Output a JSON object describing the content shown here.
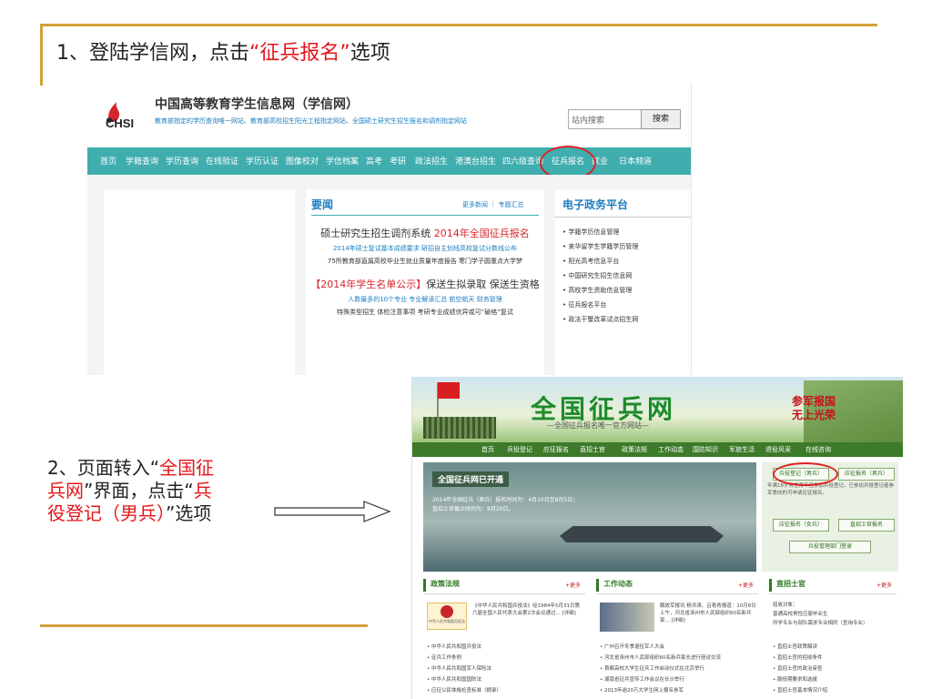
{
  "slide": {
    "step1_prefix": "1、登陆学信网，点击",
    "step1_highlight": "“征兵报名”",
    "step1_suffix": "选项",
    "step2_a": "2、页面转入“",
    "step2_b": "全国征兵网",
    "step2_c": "”界面，点击“",
    "step2_d": "兵役登记（男兵）",
    "step2_e": "”选项",
    "accent_color": "#d4a13a",
    "highlight_color": "#e3161a"
  },
  "chsi": {
    "logo_text": "CHSI",
    "site_title": "中国高等教育学生信息网（学信网）",
    "site_subtitle": "教育部指定的学历查询唯一网站、教育部高校招生阳光工程指定网站、全国硕士研究生招生报名和调剂指定网站",
    "search_placeholder": "站内搜索",
    "search_button": "搜索",
    "nav": [
      "首页",
      "学籍查询",
      "学历查询",
      "在线验证",
      "学历认证",
      "图像校对",
      "学信档案",
      "高考",
      "考研",
      "政法招生",
      "港澳台招生",
      "四六级查询",
      "征兵报名",
      "就业",
      "日本频道"
    ],
    "news": {
      "title": "要闻",
      "more": "更多新闻 ｜ 专题汇总",
      "headline1_a": "硕士研究生招生调剂系统",
      "headline1_b": "2014年全国征兵报名",
      "line1": "2014年硕士复试基本成绩要求 研招自主划线高校复试分数线公布",
      "line2": "75所教育部直属高校毕业生就业质量年度报告  寒门学子圆重点大学梦",
      "headline2_a": "【2014年学生名单公示】",
      "headline2_b": "保送生拟录取 保送生资格",
      "line3": "人数最多的10个专业 专业解读汇总 航空航天 财务管理",
      "line4": "特殊类型招生 体检注意事项  考研专业成绩优异或可“破格”复试"
    },
    "egov": {
      "title": "电子政务平台",
      "items": [
        "学籍学历信息管理",
        "来华留学生学籍学历管理",
        "阳光高考信息平台",
        "中国研究生招生信息网",
        "高校学生资助信息管理",
        "征兵报名平台",
        "政法干警改革试点招生网"
      ]
    }
  },
  "gov": {
    "title": "全国征兵网",
    "subtitle": "—全国征兵报名唯一官方网站—",
    "slogan_a": "参军报国",
    "slogan_b": "无上光荣",
    "nav": [
      "首页",
      "兵役登记",
      "应征报名",
      "直招士官",
      "政策法规",
      "工作动态",
      "国防知识",
      "军旅生活",
      "退役风采",
      "在线咨询"
    ],
    "hero_title": "全国征兵网已开通",
    "hero_line1": "2014年全国征兵（男兵）报名时间为：4月10日至8月5日；",
    "hero_line2": "直招士官截止时间为：8月20日。",
    "btn_male_reg": "兵役登记（男兵）",
    "btn_male_apply": "应征报名（男兵）",
    "side_note": "年满18岁男性青年应参加兵役登记，已参加兵役登记者参军意向的可申请应征报名。",
    "btn_female_apply": "应征报名（女兵）",
    "btn_nco": "直招士官报名",
    "btn_admin": "兵役管理部门登录",
    "policy": {
      "title": "政策法规",
      "more": "+更多",
      "snippet": "《中华人民共和国兵役法》经1984年5月31日第六届全国人民代表大会第2次会议通过... [详细]",
      "emblem_text": "中华人民共和国兵役法",
      "items": [
        "中华人民共和国兵役法",
        "征兵工作条例",
        "中华人民共和国军人保险法",
        "中华人民共和国国防法",
        "应征公民体格检查标准（摘录）"
      ]
    },
    "work": {
      "title": "工作动态",
      "more": "+更多",
      "snippet": "解放军报讯 杨洪涛、吕艳青报道：10月8日上午，河北省涿州市人武部组织60名新兵家... [详细]",
      "items": [
        "广州召开冬季退伍军人大会",
        "河北省涿州市人武部组织60名新兵家长进行座谈交流",
        "首都高校大学生征兵工作启动仪式在北京举行",
        "湖南省征兵宣传工作会议在长沙举行",
        "2013年逾20万大学生网上报名参军"
      ]
    },
    "nco": {
      "title": "直招士官",
      "more": "+更多",
      "target_label": "招收对象：",
      "target_line1": "普通高校男性应届毕业生",
      "target_line2": "所学专业与部队需求专业相同（查询专业）",
      "items": [
        "直招士官政策解读",
        "直招士官的招收条件",
        "直招士官的政治审查",
        "服役期要求和选拔",
        "直招士官基本情况介绍"
      ]
    }
  }
}
